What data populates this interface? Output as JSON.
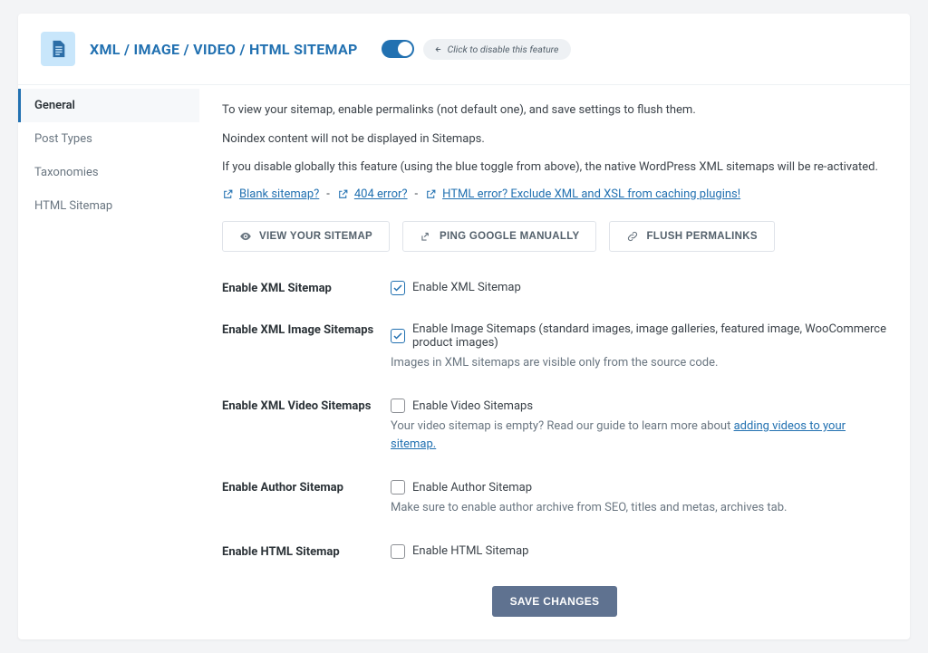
{
  "header": {
    "title": "XML / IMAGE / VIDEO / HTML SITEMAP",
    "toggle_hint": "Click to disable this feature"
  },
  "sidebar": {
    "items": [
      {
        "label": "General"
      },
      {
        "label": "Post Types"
      },
      {
        "label": "Taxonomies"
      },
      {
        "label": "HTML Sitemap"
      }
    ]
  },
  "intro": {
    "p1": "To view your sitemap, enable permalinks (not default one), and save settings to flush them.",
    "p2": "Noindex content will not be displayed in Sitemaps.",
    "p3": "If you disable globally this feature (using the blue toggle from above), the native WordPress XML sitemaps will be re-activated."
  },
  "help_links": {
    "blank": "Blank sitemap?",
    "err404": "404 error?",
    "html_err": "HTML error? Exclude XML and XSL from caching plugins!",
    "sep": "-"
  },
  "actions": {
    "view": "VIEW YOUR SITEMAP",
    "ping": "PING GOOGLE MANUALLY",
    "flush": "FLUSH PERMALINKS"
  },
  "settings": {
    "xml": {
      "label": "Enable XML Sitemap",
      "cb_label": "Enable XML Sitemap",
      "checked": true
    },
    "image": {
      "label": "Enable XML Image Sitemaps",
      "cb_label": "Enable Image Sitemaps (standard images, image galleries, featured image, WooCommerce product images)",
      "desc": "Images in XML sitemaps are visible only from the source code.",
      "checked": true
    },
    "video": {
      "label": "Enable XML Video Sitemaps",
      "cb_label": "Enable Video Sitemaps",
      "desc_pre": "Your video sitemap is empty? Read our guide to learn more about ",
      "desc_link": "adding videos to your sitemap.",
      "checked": false
    },
    "author": {
      "label": "Enable Author Sitemap",
      "cb_label": "Enable Author Sitemap",
      "desc": "Make sure to enable author archive from SEO, titles and metas, archives tab.",
      "checked": false
    },
    "html": {
      "label": "Enable HTML Sitemap",
      "cb_label": "Enable HTML Sitemap",
      "checked": false
    }
  },
  "save": "SAVE CHANGES"
}
